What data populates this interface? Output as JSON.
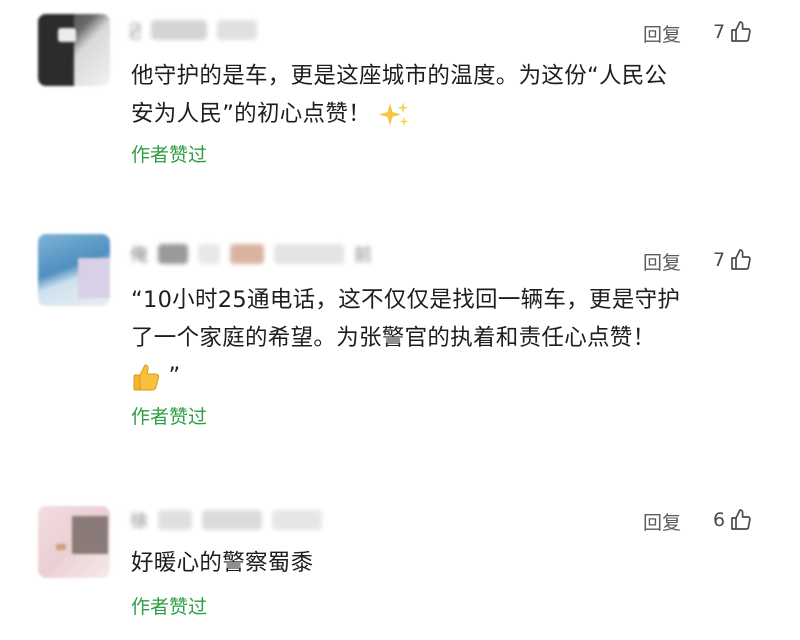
{
  "comments": [
    {
      "username": "元̷̷̷",
      "reply_label": "回复",
      "likes": "7",
      "text_line1": "他守护的是车，更是这座城市的温度。为这份“人民公",
      "text_line2": "安为人民”的初心点赞！",
      "emoji": "sparkles",
      "author_liked": "作者赞过"
    },
    {
      "username": "俺",
      "time_fragment": "前",
      "reply_label": "回复",
      "likes": "7",
      "text_line1": "“10小时25通电话，这不仅仅是找回一辆车，更是守护",
      "text_line2": "了一个家庭的希望。为张警官的执着和责任心点赞！",
      "text_line3_suffix": "”",
      "emoji": "thumbs-up",
      "author_liked": "作者赞过"
    },
    {
      "username": "徐",
      "reply_label": "回复",
      "likes": "6",
      "text_line1": "好暖心的警察蜀黍",
      "author_liked": "作者赞过"
    }
  ],
  "colors": {
    "author_liked": "#2f9e44",
    "text": "#1e1e1e",
    "meta": "#5b5b5b"
  }
}
